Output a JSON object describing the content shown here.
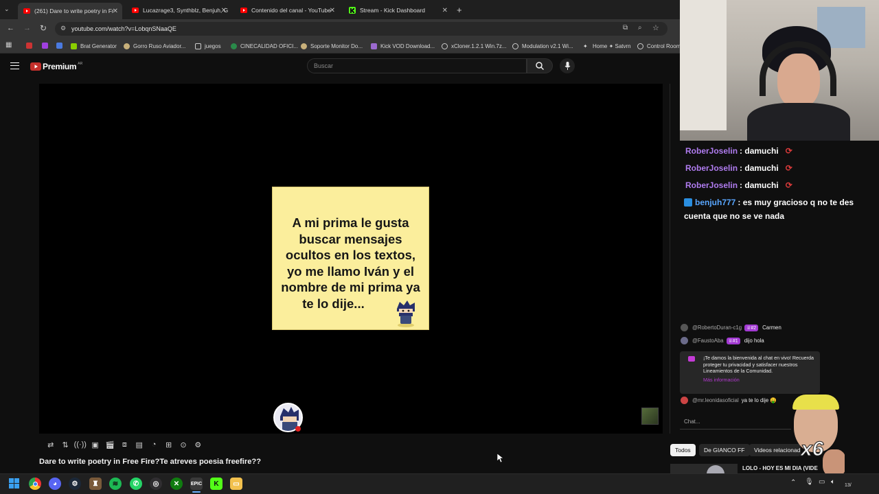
{
  "browser": {
    "tabs": [
      {
        "label": "(261) Dare to write poetry in Fr",
        "icon": "youtube-icon",
        "active": true
      },
      {
        "label": "Lucazrage3, Synthblz, Benjuh, G",
        "icon": "youtube-icon",
        "active": false
      },
      {
        "label": "Contenido del canal - YouTube",
        "icon": "youtube-icon",
        "active": false
      },
      {
        "label": "Stream - Kick Dashboard",
        "icon": "kick-icon",
        "active": false
      }
    ],
    "url": "youtube.com/watch?v=LobqnSNaaQE",
    "bookmarks": [
      "Brat Generator",
      "Gorro Ruso Aviador...",
      "juegos",
      "CINECALIDAD OFICI...",
      "Soporte Monitor Do...",
      "Kick VOD Download...",
      "xCloner.1.2.1 Win.7z...",
      "Modulation v2.1 Wi...",
      "Home ✦ Satvrn",
      "Control Room"
    ]
  },
  "youtube": {
    "logo_text": "Premium",
    "logo_sup": "AR",
    "search_placeholder": "Buscar",
    "meme_lines": [
      "A mi prima le gusta",
      "buscar mensajes",
      "ocultos en los textos,",
      "yo me llamo Iván y el",
      "nombre de mi prima ya",
      "te lo dije..."
    ],
    "video_title": "Dare to write poetry in Free Fire?Te atreves poesia freefire??",
    "chat": {
      "messages": [
        {
          "user": "@RobertoDuran-c1g",
          "badge": "♕#2",
          "text": "Carmen",
          "avatar_color": "#555"
        },
        {
          "user": "@FaustoAba",
          "badge": "♕#1",
          "text": "dijo hola",
          "avatar_color": "#6b6b8a"
        },
        {
          "user": "@mr.leonidasoficial",
          "badge": "",
          "text": "ya te lo dije 🤑",
          "avatar_color": "#c44"
        }
      ],
      "welcome_text": "¡Te damos la bienvenida al chat en vivo! Recuerda proteger tu privacidad y satisfacer nuestros Lineamientos de la Comunidad.",
      "welcome_link": "Más información",
      "input_placeholder": "Chat..."
    },
    "chips": [
      "Todos",
      "De GIANCO FF",
      "Videos relacionad"
    ],
    "related_title": "LOLO - HOY ES MI DIA (VIDE"
  },
  "kick_overlay": [
    {
      "user": "RoberJoselin",
      "text": ": damuchi"
    },
    {
      "user": "RoberJoselin",
      "text": ": damuchi"
    },
    {
      "user": "RoberJoselin",
      "text": ": damuchi"
    },
    {
      "user": "benjuh777",
      "text": ": es muy gracioso q no te des",
      "text2": "cuenta que no se ve nada"
    }
  ],
  "webcam_overlay_text": "x6",
  "taskbar": {
    "clock": "13/",
    "icons": [
      "windows-start-icon",
      "chrome-icon",
      "discord-icon",
      "steam-icon",
      "game-icon",
      "spotify-icon",
      "whatsapp-icon",
      "obs-icon",
      "xbox-icon",
      "epic-games-icon",
      "kick-icon",
      "file-explorer-icon"
    ]
  }
}
